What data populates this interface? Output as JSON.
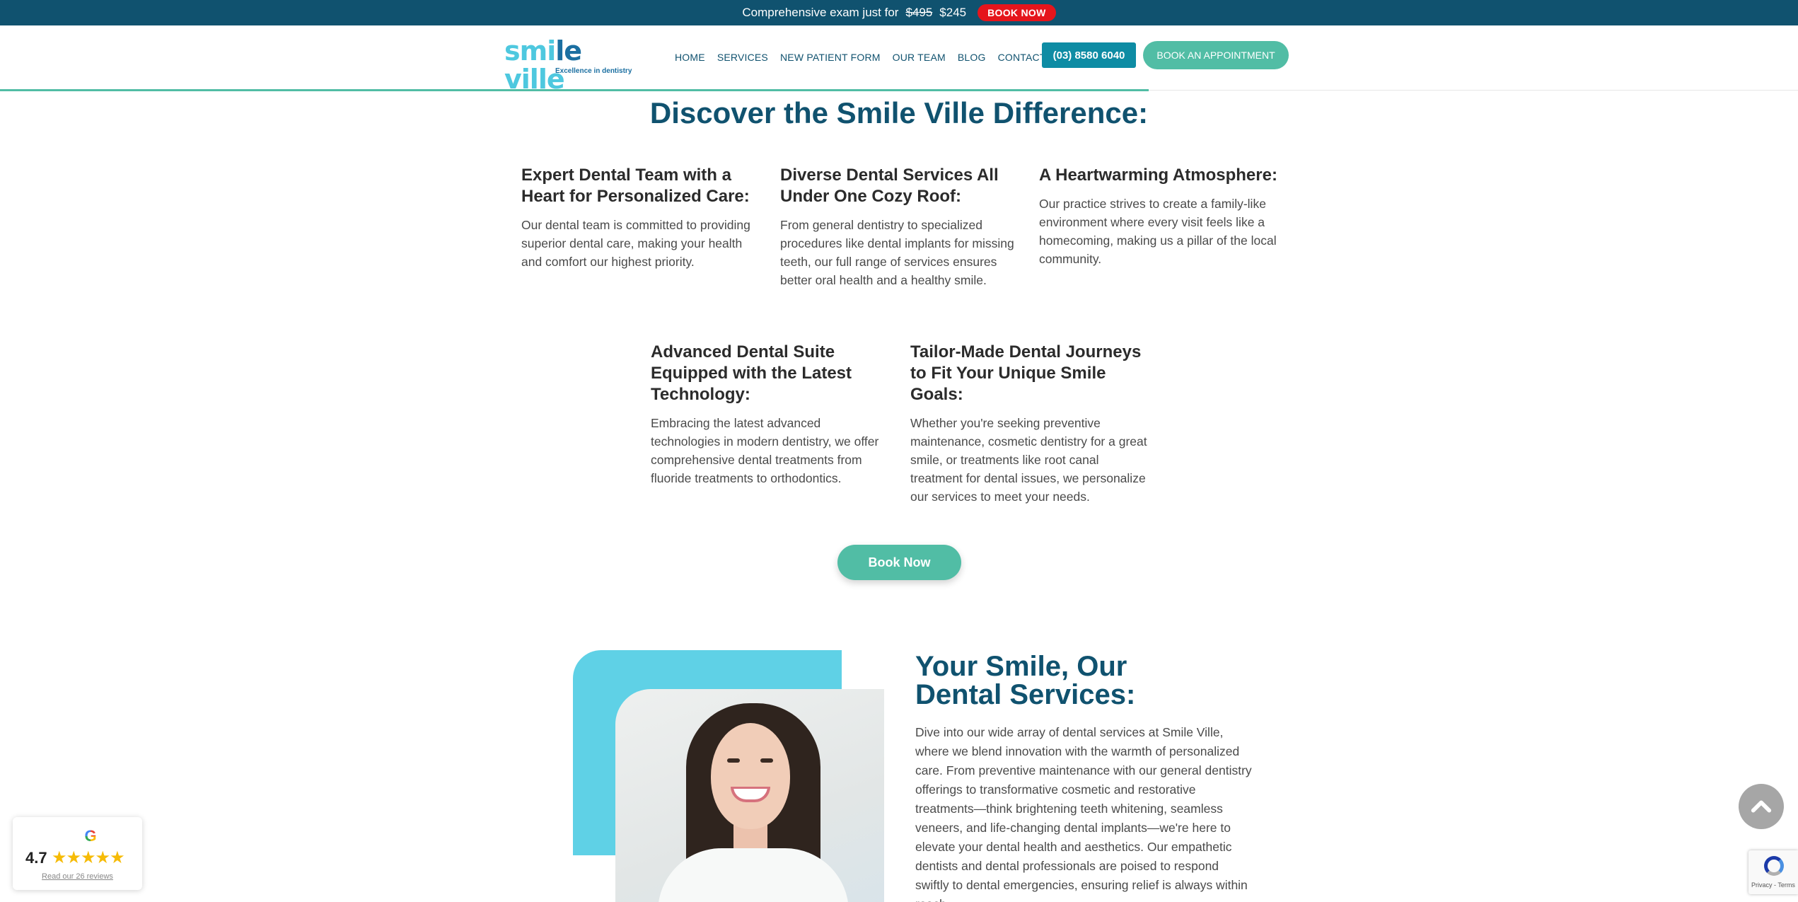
{
  "promo": {
    "text": "Comprehensive exam just for",
    "old_price": "$495",
    "new_price": "$245",
    "button": "BOOK NOW"
  },
  "logo": {
    "main_part1": "smi",
    "main_part2": "le",
    "main_part3": " ville",
    "tagline": "Excellence in dentistry"
  },
  "nav": {
    "items": [
      "HOME",
      "SERVICES",
      "NEW PATIENT FORM",
      "OUR TEAM",
      "BLOG",
      "CONTACT US"
    ],
    "phone": "(03) 8580 6040",
    "book_appointment": "BOOK AN APPOINTMENT"
  },
  "discover": {
    "title": "Discover the Smile Ville Difference:",
    "features": [
      {
        "title": "Expert Dental Team with a Heart for Personalized Care:",
        "text": "Our dental team is committed to providing superior dental care, making your health and comfort our highest priority."
      },
      {
        "title": "Diverse Dental Services All Under One Cozy Roof:",
        "text": "From general dentistry to specialized procedures like dental implants for missing teeth, our full range of services ensures better oral health and a healthy smile."
      },
      {
        "title": "A Heartwarming Atmosphere:",
        "text": "Our practice strives to create a family-like environment where every visit feels like a homecoming, making us a pillar of the local community."
      },
      {
        "title": "Advanced Dental Suite Equipped with the Latest Technology:",
        "text": "Embracing the latest advanced technologies in modern dentistry, we offer comprehensive dental treatments from fluoride treatments to orthodontics."
      },
      {
        "title": "Tailor-Made Dental Journeys to Fit Your Unique Smile Goals:",
        "text": "Whether you're seeking preventive maintenance, cosmetic dentistry for a great smile, or treatments like root canal treatment for dental issues, we personalize our services to meet your needs."
      }
    ],
    "book_now": "Book Now"
  },
  "services": {
    "title": "Your Smile, Our Dental Services:",
    "text": "Dive into our wide array of dental services at Smile Ville, where we blend innovation with the warmth of personalized care. From preventive maintenance with our general dentistry offerings to transformative cosmetic and restorative treatments—think brightening teeth whitening, seamless veneers, and life-changing dental implants—we're here to elevate your dental health and aesthetics. Our empathetic dentists and dental professionals are poised to respond swiftly to dental emergencies, ensuring relief is always within reach."
  },
  "reviews": {
    "rating": "4.7",
    "stars": "★★★★★",
    "link": "Read our 26 reviews"
  },
  "recaptcha": {
    "text": "Privacy - Terms"
  }
}
